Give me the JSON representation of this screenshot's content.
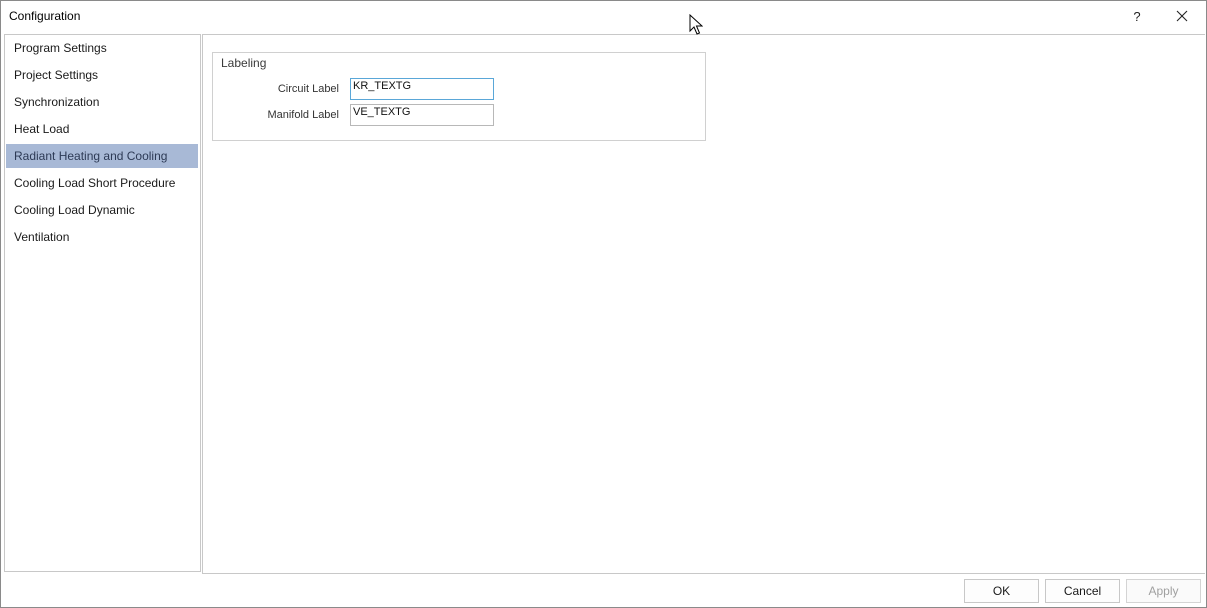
{
  "window": {
    "title": "Configuration",
    "help_label": "?",
    "close_icon": "close-icon"
  },
  "sidebar": {
    "items": [
      {
        "label": "Program Settings",
        "selected": false
      },
      {
        "label": "Project Settings",
        "selected": false
      },
      {
        "label": "Synchronization",
        "selected": false
      },
      {
        "label": "Heat Load",
        "selected": false
      },
      {
        "label": "Radiant Heating and Cooling",
        "selected": true
      },
      {
        "label": "Cooling Load Short Procedure",
        "selected": false
      },
      {
        "label": "Cooling Load Dynamic",
        "selected": false
      },
      {
        "label": "Ventilation",
        "selected": false
      }
    ]
  },
  "labeling": {
    "group_title": "Labeling",
    "circuit_label": "Circuit Label",
    "circuit_value": "KR_TEXTG",
    "manifold_label": "Manifold Label",
    "manifold_value": "VE_TEXTG"
  },
  "buttons": {
    "ok": "OK",
    "cancel": "Cancel",
    "apply": "Apply"
  },
  "colors": {
    "selected_item_bg": "#a8b9d6",
    "focused_border": "#5aa7d8"
  }
}
